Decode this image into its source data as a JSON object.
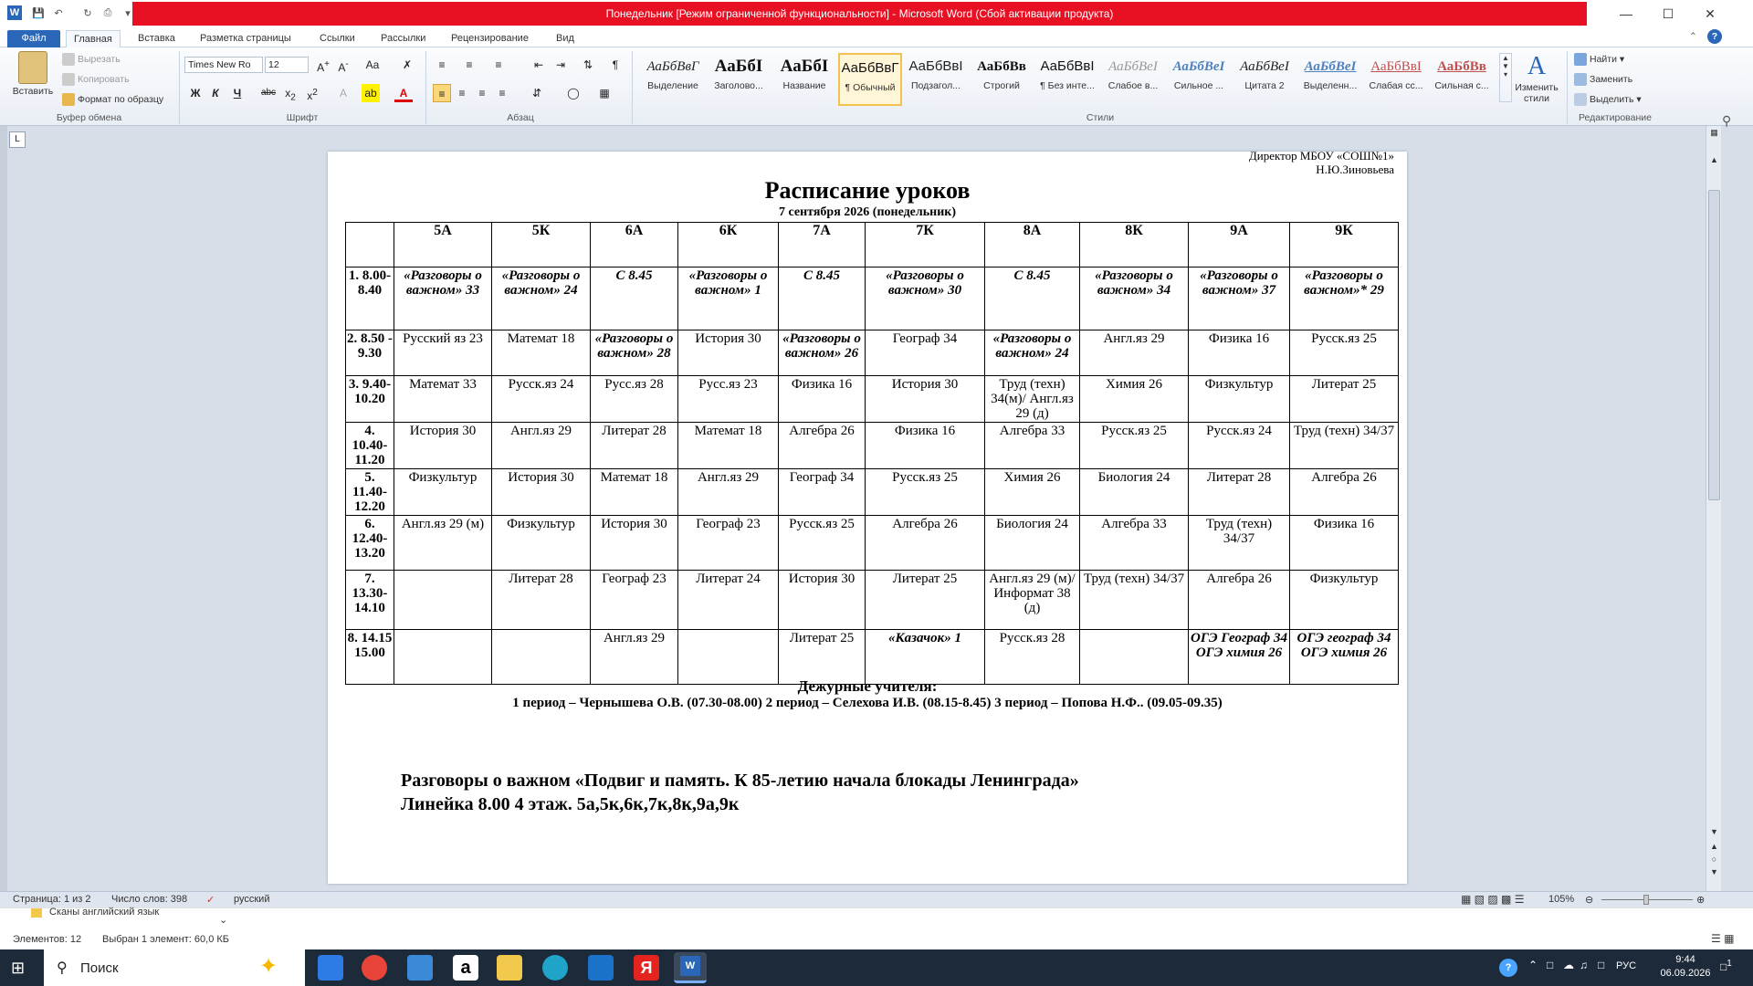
{
  "window": {
    "title": "Понедельник [Режим ограниченной функциональности] - Microsoft Word (Сбой активации продукта)",
    "colors": {
      "title_bar": "#e81123",
      "file_tab": "#2a67b8"
    }
  },
  "tabs": [
    "Файл",
    "Главная",
    "Вставка",
    "Разметка страницы",
    "Ссылки",
    "Рассылки",
    "Рецензирование",
    "Вид"
  ],
  "ribbon": {
    "clipboard": {
      "paste": "Вставить",
      "cut": "Вырезать",
      "copy": "Копировать",
      "format_painter": "Формат по образцу",
      "label": "Буфер обмена"
    },
    "font": {
      "name": "Times New Ro",
      "size": "12",
      "label": "Шрифт",
      "bold": "Ж",
      "italic": "К",
      "underline": "Ч"
    },
    "paragraph": {
      "label": "Абзац"
    },
    "styles": {
      "label": "Стили",
      "items": [
        {
          "sample": "АаБбВвГ",
          "name": "Выделение"
        },
        {
          "sample": "АаБбІ",
          "name": "Заголово..."
        },
        {
          "sample": "АаБбІ",
          "name": "Название"
        },
        {
          "sample": "АаБбВвГ",
          "name": "¶ Обычный"
        },
        {
          "sample": "АаБбВвІ",
          "name": "Подзагол..."
        },
        {
          "sample": "АаБбВв",
          "name": "Строгий"
        },
        {
          "sample": "АаБбВвІ",
          "name": "¶ Без инте..."
        },
        {
          "sample": "АаБбВеІ",
          "name": "Слабое в..."
        },
        {
          "sample": "АаБбВеІ",
          "name": "Сильное ..."
        },
        {
          "sample": "АаБбВеІ",
          "name": "Цитата 2"
        },
        {
          "sample": "АаБбВеІ",
          "name": "Выделенн..."
        },
        {
          "sample": "АаБбВвІ",
          "name": "Слабая сс..."
        },
        {
          "sample": "АаБбВв",
          "name": "Сильная с..."
        }
      ],
      "change": "Изменить стили"
    },
    "editing": {
      "find": "Найти",
      "replace": "Заменить",
      "select": "Выделить",
      "label": "Редактирование"
    }
  },
  "document": {
    "header_line1": "Директор МБОУ «СОШ№1»",
    "header_line2": "Н.Ю.Зиновьева",
    "title": "Расписание уроков",
    "date": "7 сентября  2026  (понедельник)",
    "classes": [
      "5А",
      "5К",
      "6А",
      "6К",
      "7А",
      "7К",
      "8А",
      "8К",
      "9А",
      "9К"
    ],
    "periods": [
      {
        "label": "1. 8.00- 8.40",
        "cells": [
          {
            "t": "«Разговоры о важном» 33",
            "s": "bi"
          },
          {
            "t": "«Разговоры о важном» 24",
            "s": "bi"
          },
          {
            "t": "С 8.45",
            "s": "bi"
          },
          {
            "t": "«Разговоры о важном» 1",
            "s": "bi"
          },
          {
            "t": "С 8.45",
            "s": "bi"
          },
          {
            "t": "«Разговоры о важном» 30",
            "s": "bi"
          },
          {
            "t": "С 8.45",
            "s": "bi"
          },
          {
            "t": "«Разговоры о важном» 34",
            "s": "bi"
          },
          {
            "t": "«Разговоры о важном» 37",
            "s": "bi"
          },
          {
            "t": "«Разговоры о важном»* 29",
            "s": "bi"
          }
        ]
      },
      {
        "label": "2. 8.50 - 9.30",
        "cells": [
          {
            "t": "Русский яз 23",
            "s": "n"
          },
          {
            "t": "Математ 18",
            "s": "n"
          },
          {
            "t": "«Разговоры о важном» 28",
            "s": "bi"
          },
          {
            "t": "История 30",
            "s": "n"
          },
          {
            "t": "«Разговоры о важном» 26",
            "s": "bi"
          },
          {
            "t": "Географ 34",
            "s": "sm"
          },
          {
            "t": "«Разговоры о важном» 24",
            "s": "bi"
          },
          {
            "t": "Англ.яз 29",
            "s": "n"
          },
          {
            "t": "Физика 16",
            "s": "n"
          },
          {
            "t": "Русск.яз 25",
            "s": "sm"
          }
        ]
      },
      {
        "label": "3. 9.40- 10.20",
        "cells": [
          {
            "t": "Математ 33",
            "s": "n"
          },
          {
            "t": "Русск.яз 24",
            "s": "sm"
          },
          {
            "t": "Русс.яз 28",
            "s": "n"
          },
          {
            "t": "Русс.яз 23",
            "s": "n"
          },
          {
            "t": "Физика 16",
            "s": "n"
          },
          {
            "t": "История 30",
            "s": "n"
          },
          {
            "t": "Труд (техн) 34(м)/ Англ.яз 29 (д)",
            "s": "sm"
          },
          {
            "t": "Химия 26",
            "s": "n"
          },
          {
            "t": "Физкультур",
            "s": "n"
          },
          {
            "t": "Литерат 25",
            "s": "sm"
          }
        ]
      },
      {
        "label": "4. 10.40- 11.20",
        "cells": [
          {
            "t": "История 30",
            "s": "n"
          },
          {
            "t": "Англ.яз 29",
            "s": "n"
          },
          {
            "t": "Литерат 28",
            "s": "n"
          },
          {
            "t": "Математ 18",
            "s": "n"
          },
          {
            "t": "Алгебра 26",
            "s": "n"
          },
          {
            "t": "Физика 16",
            "s": "n"
          },
          {
            "t": "Алгебра 33",
            "s": "n"
          },
          {
            "t": "Русск.яз 25",
            "s": "sm"
          },
          {
            "t": "Русск.яз 24",
            "s": "sm"
          },
          {
            "t": "Труд (техн) 34/37",
            "s": "sm"
          }
        ]
      },
      {
        "label": "5. 11.40- 12.20",
        "cells": [
          {
            "t": "Физкультур",
            "s": "n"
          },
          {
            "t": "История 30",
            "s": "n"
          },
          {
            "t": "Математ 18",
            "s": "n"
          },
          {
            "t": "Англ.яз 29",
            "s": "n"
          },
          {
            "t": "Географ 34",
            "s": "sm"
          },
          {
            "t": "Русск.яз 25",
            "s": "sm"
          },
          {
            "t": "Химия 26",
            "s": "n"
          },
          {
            "t": "Биология 24",
            "s": "n"
          },
          {
            "t": "Литерат 28",
            "s": "sm"
          },
          {
            "t": "Алгебра 26",
            "s": "n"
          }
        ]
      },
      {
        "label": "6. 12.40- 13.20",
        "cells": [
          {
            "t": "Англ.яз 29 (м)",
            "s": "n"
          },
          {
            "t": "Физкультур",
            "s": "n"
          },
          {
            "t": "История 30",
            "s": "n"
          },
          {
            "t": "Географ 23",
            "s": "n"
          },
          {
            "t": "Русск.яз 25",
            "s": "sm"
          },
          {
            "t": "Алгебра 26",
            "s": "n"
          },
          {
            "t": "Биология 24",
            "s": "n"
          },
          {
            "t": "Алгебра 33",
            "s": "n"
          },
          {
            "t": "Труд (техн) 34/37",
            "s": "sm"
          },
          {
            "t": "Физика 16",
            "s": "n"
          }
        ]
      },
      {
        "label": "7. 13.30- 14.10",
        "cells": [
          {
            "t": "",
            "s": "n"
          },
          {
            "t": "Литерат 28",
            "s": "sm"
          },
          {
            "t": "Географ 23",
            "s": "n"
          },
          {
            "t": "Литерат 24",
            "s": "n"
          },
          {
            "t": "История 30",
            "s": "n"
          },
          {
            "t": "Литерат 25",
            "s": "sm"
          },
          {
            "t": "Англ.яз 29 (м)/ Информат 38 (д)",
            "s": "sm"
          },
          {
            "t": "Труд (техн) 34/37",
            "s": "sm"
          },
          {
            "t": "Алгебра 26",
            "s": "n"
          },
          {
            "t": "Физкультур",
            "s": "n"
          }
        ]
      },
      {
        "label": "8. 14.15 15.00",
        "cells": [
          {
            "t": "",
            "s": "n"
          },
          {
            "t": "",
            "s": "n"
          },
          {
            "t": "Англ.яз 29",
            "s": "n"
          },
          {
            "t": "",
            "s": "n"
          },
          {
            "t": "Литерат 25",
            "s": "sm"
          },
          {
            "t": "«Казачок» 1",
            "s": "bi"
          },
          {
            "t": "Русск.яз 28",
            "s": "sm"
          },
          {
            "t": "",
            "s": "n"
          },
          {
            "t": "ОГЭ Географ 34 ОГЭ химия 26",
            "s": "bi2"
          },
          {
            "t": "ОГЭ географ 34 ОГЭ химия 26",
            "s": "bi2"
          }
        ]
      }
    ],
    "duty_title": "Дежурные учителя:",
    "duty_text": "1 период – Чернышева О.В.  (07.30-08.00) 2 период –  Селехова И.В.  (08.15-8.45) 3 период – Попова Н.Ф..  (09.05-09.35)",
    "line1": "Разговоры о важном «Подвиг и память. К 85-летию начала блокады Ленинграда»",
    "line2": "Линейка 8.00 4 этаж. 5а,5к,6к,7к,8к,9а,9к"
  },
  "statusbar": {
    "page": "Страница: 1 из 2",
    "words": "Число слов: 398",
    "lang": "русский",
    "zoom": "105%"
  },
  "explorer": {
    "folder": "Сканы английский язык",
    "items": "Элементов: 12",
    "selected": "Выбран 1 элемент: 60,0 КБ"
  },
  "taskbar": {
    "search": "Поиск",
    "lang": "РУС",
    "time": "9:44",
    "date": "06.09.2026",
    "notif": "1"
  }
}
